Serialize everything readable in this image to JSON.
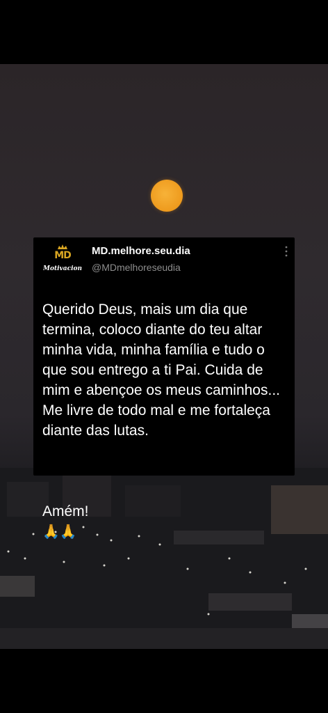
{
  "post": {
    "avatar_monogram": "MD",
    "avatar_tagline": "Motivacional",
    "display_name": "MD.melhore.seu.dia",
    "handle": "@MDmelhoreseudia",
    "text": "Querido Deus, mais um dia que termina, coloco diante do teu altar minha vida, minha família e tudo o que sou entrego a ti Pai. Cuida de mim e abençoe os meus caminhos... Me livre de todo mal e me fortaleça diante das lutas.",
    "closing": "Amém!",
    "closing_emoji": "🙏🙏",
    "more_icon": "more-vertical-icon"
  },
  "colors": {
    "sun": "#ee9a1d",
    "brand_gold": "#d9a622",
    "card_bg": "#000000",
    "handle_gray": "#8d8d8d"
  }
}
